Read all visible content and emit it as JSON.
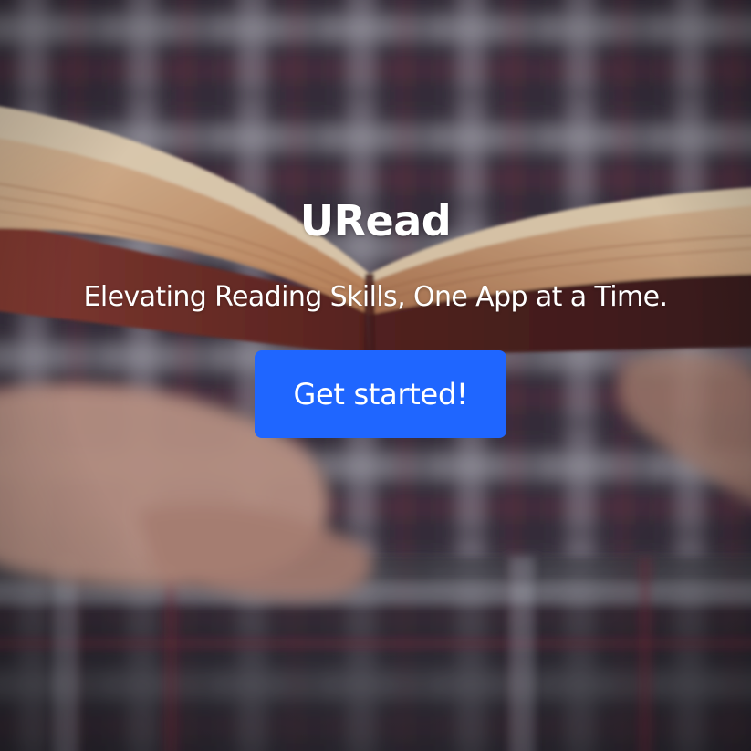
{
  "hero": {
    "background_image": "blurred photo of a person in a plaid shirt holding an open book",
    "title": "URead",
    "subtitle": "Elevating Reading Skills, One App at a Time.",
    "cta_label": "Get started!"
  },
  "colors": {
    "accent": "#1f66ff",
    "text": "#ffffff"
  }
}
